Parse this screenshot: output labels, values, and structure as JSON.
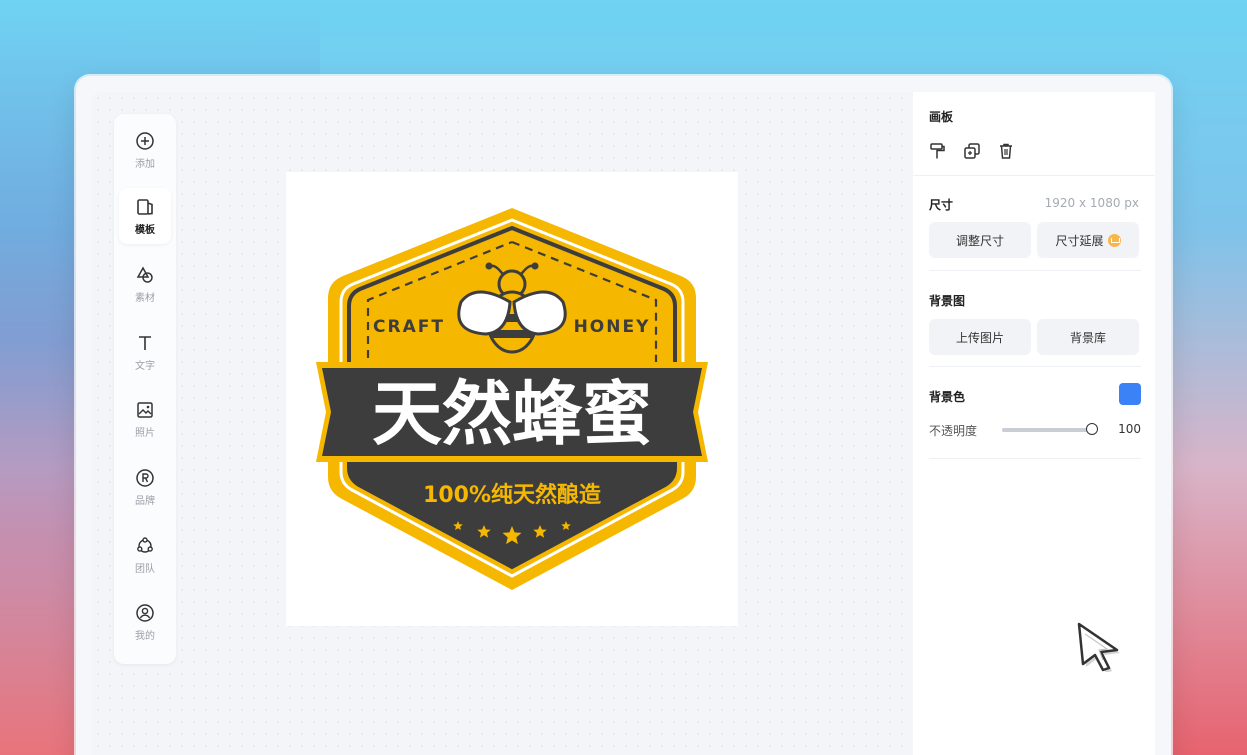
{
  "sidebar": {
    "items": [
      {
        "label": "添加",
        "icon": "plus-circle-icon"
      },
      {
        "label": "模板",
        "icon": "template-icon",
        "active": true
      },
      {
        "label": "素材",
        "icon": "shapes-icon"
      },
      {
        "label": "文字",
        "icon": "text-icon"
      },
      {
        "label": "照片",
        "icon": "image-icon"
      },
      {
        "label": "品牌",
        "icon": "registered-icon"
      },
      {
        "label": "团队",
        "icon": "team-icon"
      },
      {
        "label": "我的",
        "icon": "user-icon"
      }
    ]
  },
  "canvas": {
    "logo": {
      "left_text": "CRAFT",
      "right_text": "HONEY",
      "title": "天然蜂蜜",
      "subtitle": "100%纯天然酿造",
      "star_count": 5
    }
  },
  "panel": {
    "board_title": "画板",
    "tools": [
      {
        "icon": "format-painter-icon"
      },
      {
        "icon": "duplicate-icon"
      },
      {
        "icon": "trash-icon"
      }
    ],
    "size": {
      "title": "尺寸",
      "value": "1920 x 1080 px",
      "resize_label": "调整尺寸",
      "extend_label": "尺寸延展"
    },
    "background_image": {
      "title": "背景图",
      "upload_label": "上传图片",
      "library_label": "背景库"
    },
    "background_color": {
      "title": "背景色",
      "color": "#3b82f6",
      "opacity_label": "不透明度",
      "opacity_value": "100"
    }
  },
  "colors": {
    "honey_yellow": "#f5b700",
    "badge_dark": "#3d3d3d",
    "accent_blue": "#3b82f6"
  }
}
